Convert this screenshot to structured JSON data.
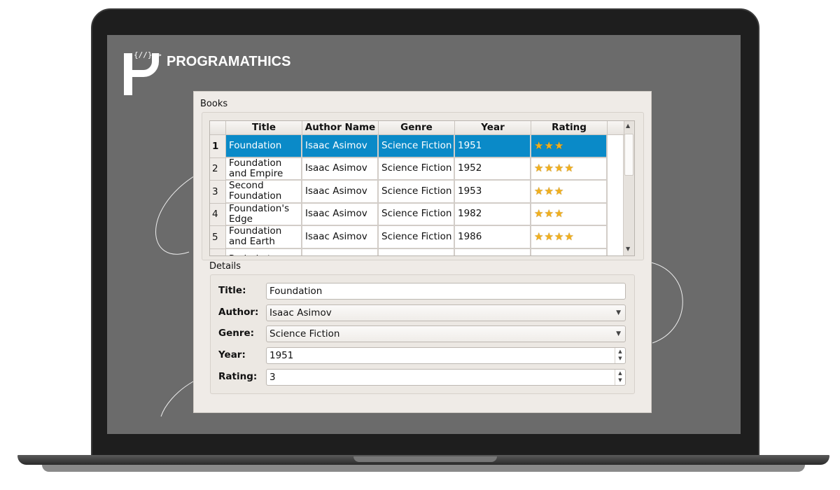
{
  "brand": {
    "name": "PROGRAMATHICS",
    "logo_code": "{//}<>"
  },
  "books_group": {
    "label": "Books",
    "columns": [
      "Title",
      "Author Name",
      "Genre",
      "Year",
      "Rating"
    ],
    "rows": [
      {
        "index": "1",
        "title": "Foundation",
        "author": "Isaac Asimov",
        "genre": "Science Fiction",
        "year": "1951",
        "rating": 3,
        "selected": true
      },
      {
        "index": "2",
        "title": "Foundation and Empire",
        "author": "Isaac Asimov",
        "genre": "Science Fiction",
        "year": "1952",
        "rating": 4
      },
      {
        "index": "3",
        "title": "Second Foundation",
        "author": "Isaac Asimov",
        "genre": "Science Fiction",
        "year": "1953",
        "rating": 3
      },
      {
        "index": "4",
        "title": "Foundation's Edge",
        "author": "Isaac Asimov",
        "genre": "Science Fiction",
        "year": "1982",
        "rating": 3
      },
      {
        "index": "5",
        "title": "Foundation and Earth",
        "author": "Isaac Asimov",
        "genre": "Science Fiction",
        "year": "1986",
        "rating": 4
      },
      {
        "index": "",
        "title": "Prelude to",
        "author": "",
        "genre": "",
        "year": "",
        "rating": 0
      }
    ]
  },
  "details_group": {
    "label": "Details",
    "title_label": "Title:",
    "title_value": "Foundation",
    "author_label": "Author:",
    "author_value": "Isaac Asimov",
    "genre_label": "Genre:",
    "genre_value": "Science Fiction",
    "year_label": "Year:",
    "year_value": "1951",
    "rating_label": "Rating:",
    "rating_value": "3"
  },
  "colors": {
    "selection": "#0a8ac8",
    "star": "#f2b01c",
    "screen": "#6b6b6b"
  }
}
